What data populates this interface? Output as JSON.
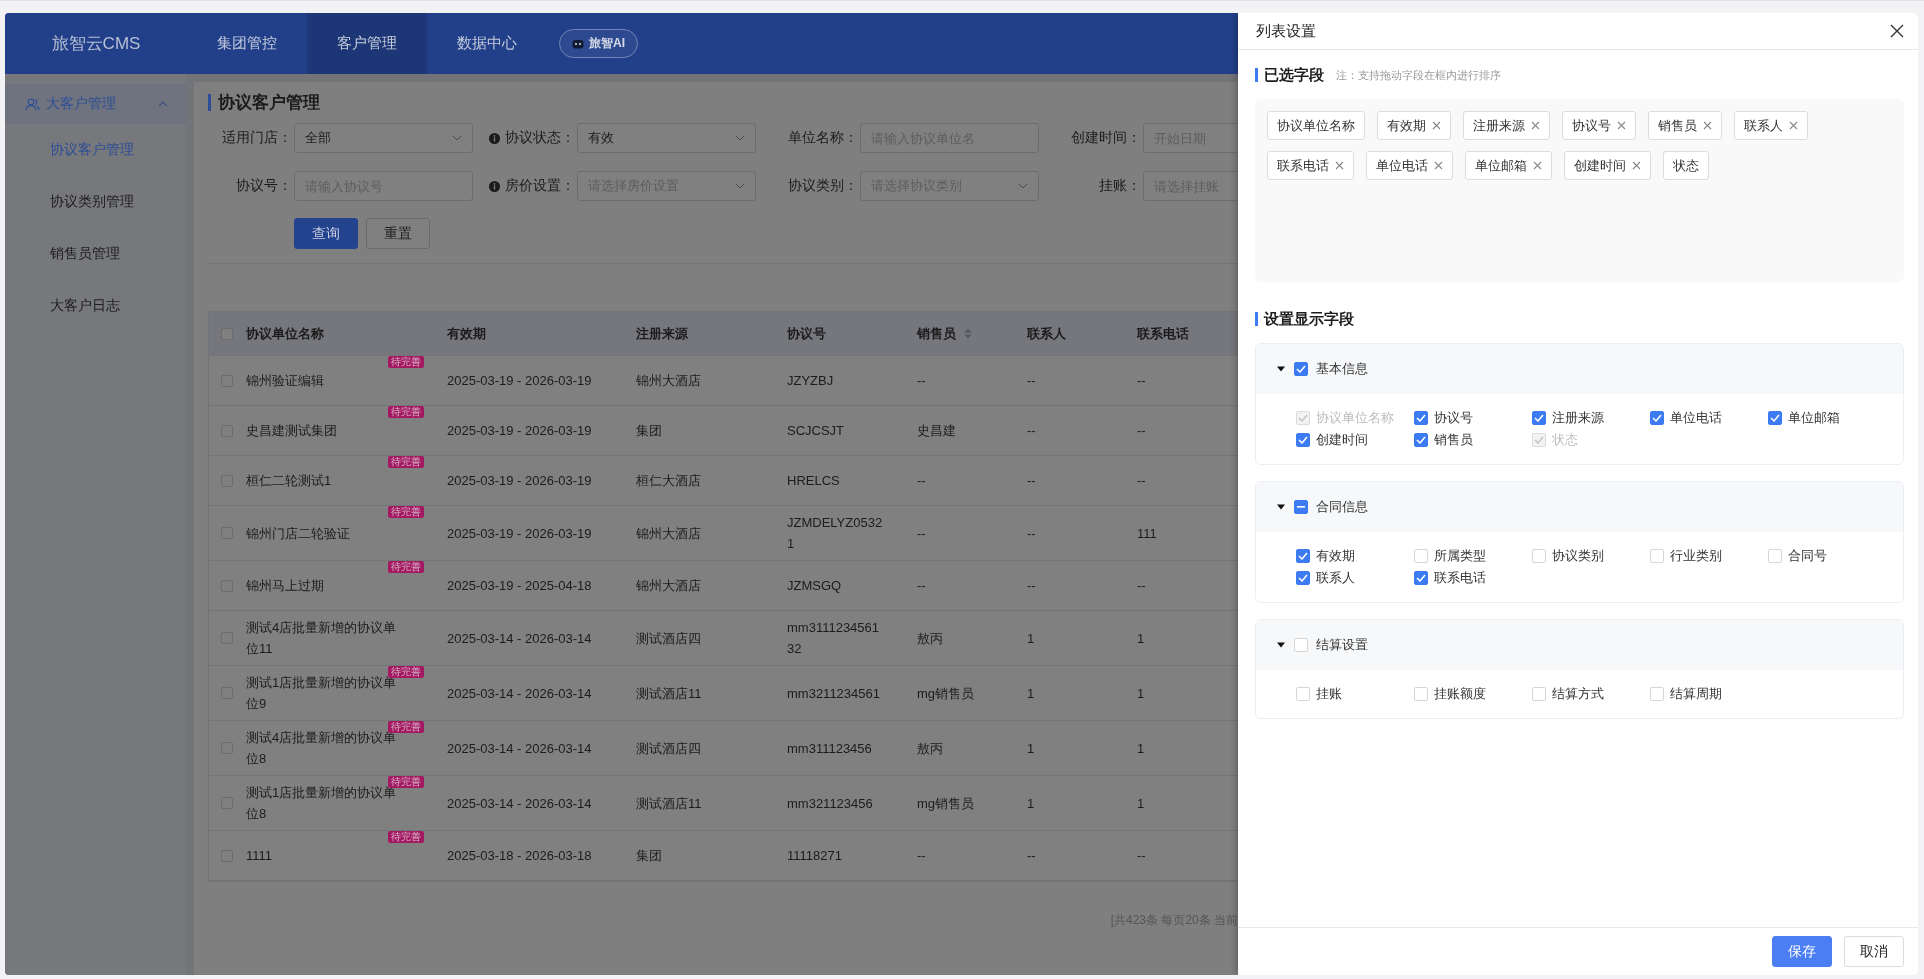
{
  "header": {
    "logo": "旅智云CMS",
    "nav": [
      {
        "label": "集团管控",
        "selected": false
      },
      {
        "label": "客户管理",
        "selected": true
      },
      {
        "label": "数据中心",
        "selected": false
      }
    ],
    "ai_button": "旅智AI"
  },
  "sidebar": {
    "groups": [
      {
        "label": "大客户管理",
        "expanded": true,
        "children": [
          {
            "label": "协议客户管理",
            "selected": true
          },
          {
            "label": "协议类别管理",
            "selected": false
          },
          {
            "label": "销售员管理",
            "selected": false
          },
          {
            "label": "大客户日志",
            "selected": false
          }
        ]
      }
    ]
  },
  "page": {
    "title": "协议客户管理",
    "filters": [
      {
        "kind": "select",
        "label": "适用门店：",
        "info": false,
        "value": "全部"
      },
      {
        "kind": "select",
        "label": "协议状态：",
        "info": true,
        "value": "有效"
      },
      {
        "kind": "input",
        "label": "单位名称：",
        "info": false,
        "placeholder": "请输入协议单位名"
      },
      {
        "kind": "input",
        "label": "创建时间：",
        "info": false,
        "placeholder": "开始日期"
      },
      {
        "kind": "input",
        "label": "协议号：",
        "info": false,
        "placeholder": "请输入协议号"
      },
      {
        "kind": "select",
        "label": "房价设置：",
        "info": true,
        "placeholder": "请选择房价设置"
      },
      {
        "kind": "select",
        "label": "协议类别：",
        "info": false,
        "placeholder": "请选择协议类别"
      },
      {
        "kind": "input",
        "label": "挂账：",
        "info": false,
        "placeholder": "请选择挂账"
      }
    ],
    "buttons": [
      {
        "label": "查询",
        "kind": "primary"
      },
      {
        "label": "重置",
        "kind": "default"
      }
    ]
  },
  "table": {
    "all_checked": false,
    "columns": [
      {
        "label": "协议单位名称",
        "sortable": false
      },
      {
        "label": "有效期",
        "sortable": false
      },
      {
        "label": "注册来源",
        "sortable": false
      },
      {
        "label": "协议号",
        "sortable": false
      },
      {
        "label": "销售员",
        "sortable": true
      },
      {
        "label": "联系人",
        "sortable": false
      },
      {
        "label": "联系电话",
        "sortable": false
      }
    ],
    "rows": [
      {
        "checked": false,
        "tag": "待完善",
        "cells": [
          "锦州验证编辑",
          "2025-03-19 - 2026-03-19",
          "锦州大酒店",
          "JZYZBJ",
          "--",
          "--",
          "--"
        ]
      },
      {
        "checked": false,
        "tag": "待完善",
        "cells": [
          "史昌建测试集团",
          "2025-03-19 - 2026-03-19",
          "集团",
          "SCJCSJT",
          "史昌建",
          "--",
          "--"
        ]
      },
      {
        "checked": false,
        "tag": "待完善",
        "cells": [
          "桓仁二轮测试1",
          "2025-03-19 - 2026-03-19",
          "桓仁大酒店",
          "HRELCS",
          "--",
          "--",
          "--"
        ]
      },
      {
        "checked": false,
        "tag": "待完善",
        "cells": [
          "锦州门店二轮验证",
          "2025-03-19 - 2026-03-19",
          "锦州大酒店",
          "JZMDELYZ05321",
          "--",
          "--",
          "111"
        ]
      },
      {
        "checked": false,
        "tag": "待完善",
        "cells": [
          "锦州马上过期",
          "2025-03-19 - 2025-04-18",
          "锦州大酒店",
          "JZMSGQ",
          "--",
          "--",
          "--"
        ]
      },
      {
        "checked": false,
        "cells": [
          "测试4店批量新增的协议单位11",
          "2025-03-14 - 2026-03-14",
          "测试酒店四",
          "mm311123456132",
          "敖丙",
          "1",
          "1"
        ]
      },
      {
        "checked": false,
        "tag": "待完善",
        "cells": [
          "测试1店批量新增的协议单位9",
          "2025-03-14 - 2026-03-14",
          "测试酒店11",
          "mm3211234561",
          "mg销售员",
          "1",
          "1"
        ]
      },
      {
        "checked": false,
        "tag": "待完善",
        "cells": [
          "测试4店批量新增的协议单位8",
          "2025-03-14 - 2026-03-14",
          "测试酒店四",
          "mm311123456",
          "敖丙",
          "1",
          "1"
        ]
      },
      {
        "checked": false,
        "tag": "待完善",
        "cells": [
          "测试1店批量新增的协议单位8",
          "2025-03-14 - 2026-03-14",
          "测试酒店11",
          "mm321123456",
          "mg销售员",
          "1",
          "1"
        ]
      },
      {
        "checked": false,
        "tag": "待完善",
        "cells": [
          "1111",
          "2025-03-18 - 2026-03-18",
          "集团",
          "11118271",
          "--",
          "--",
          "--"
        ]
      }
    ],
    "pagination": "[共423条 每页20条 当前"
  },
  "drawer": {
    "title": "列表设置",
    "selected_section": {
      "title": "已选字段",
      "note": "注：支持拖动字段在框内进行排序",
      "tags": [
        {
          "label": "协议单位名称",
          "removable": false
        },
        {
          "label": "有效期",
          "removable": true
        },
        {
          "label": "注册来源",
          "removable": true
        },
        {
          "label": "协议号",
          "removable": true
        },
        {
          "label": "销售员",
          "removable": true
        },
        {
          "label": "联系人",
          "removable": true
        },
        {
          "label": "联系电话",
          "removable": true
        },
        {
          "label": "单位电话",
          "removable": true
        },
        {
          "label": "单位邮箱",
          "removable": true
        },
        {
          "label": "创建时间",
          "removable": true
        },
        {
          "label": "状态",
          "removable": false
        }
      ]
    },
    "display_section": {
      "title": "设置显示字段",
      "groups": [
        {
          "label": "基本信息",
          "expanded": true,
          "checked": true,
          "indeterminate": false,
          "items": [
            {
              "label": "协议单位名称",
              "checked": true,
              "disabled": true
            },
            {
              "label": "协议号",
              "checked": true,
              "disabled": false
            },
            {
              "label": "注册来源",
              "checked": true,
              "disabled": false
            },
            {
              "label": "单位电话",
              "checked": true,
              "disabled": false
            },
            {
              "label": "单位邮箱",
              "checked": true,
              "disabled": false
            },
            {
              "label": "创建时间",
              "checked": true,
              "disabled": false
            },
            {
              "label": "销售员",
              "checked": true,
              "disabled": false
            },
            {
              "label": "状态",
              "checked": true,
              "disabled": true
            }
          ]
        },
        {
          "label": "合同信息",
          "expanded": true,
          "checked": true,
          "indeterminate": true,
          "items": [
            {
              "label": "有效期",
              "checked": true,
              "disabled": false
            },
            {
              "label": "所属类型",
              "checked": false,
              "disabled": false
            },
            {
              "label": "协议类别",
              "checked": false,
              "disabled": false
            },
            {
              "label": "行业类别",
              "checked": false,
              "disabled": false
            },
            {
              "label": "合同号",
              "checked": false,
              "disabled": false
            },
            {
              "label": "联系人",
              "checked": true,
              "disabled": false
            },
            {
              "label": "联系电话",
              "checked": true,
              "disabled": false
            }
          ]
        },
        {
          "label": "结算设置",
          "expanded": true,
          "checked": false,
          "indeterminate": false,
          "items": [
            {
              "label": "挂账",
              "checked": false,
              "disabled": false
            },
            {
              "label": "挂账额度",
              "checked": false,
              "disabled": false
            },
            {
              "label": "结算方式",
              "checked": false,
              "disabled": false
            },
            {
              "label": "结算周期",
              "checked": false,
              "disabled": false
            }
          ]
        }
      ]
    },
    "buttons": [
      {
        "label": "保存",
        "kind": "primary"
      },
      {
        "label": "取消",
        "kind": "default"
      }
    ]
  }
}
